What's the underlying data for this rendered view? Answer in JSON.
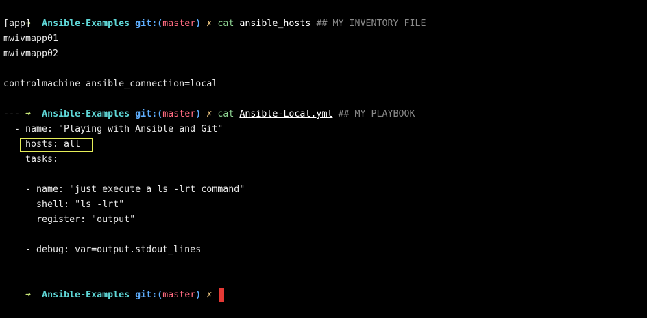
{
  "prompt": {
    "arrow": "➜",
    "directory": "Ansible-Examples",
    "git_label": "git:(",
    "branch": "master",
    "git_close": ")",
    "dirty_mark": "✗"
  },
  "commands": [
    {
      "cmd": "cat",
      "file": "ansible_hosts",
      "comment": "## MY INVENTORY FILE"
    },
    {
      "cmd": "cat",
      "file": "Ansible-Local.yml",
      "comment": "## MY PLAYBOOK"
    }
  ],
  "inventory_output": [
    "[app]",
    "mwivmapp01",
    "mwivmapp02",
    "",
    "controlmachine ansible_connection=local"
  ],
  "playbook_output": [
    "---",
    "  - name: \"Playing with Ansible and Git\"",
    "    hosts: all",
    "    tasks:",
    "",
    "    - name: \"just execute a ls -lrt command\"",
    "      shell: \"ls -lrt\"",
    "      register: \"output\"",
    "",
    "    - debug: var=output.stdout_lines"
  ],
  "colors": {
    "background": "#000000",
    "arrow": "#c5e478",
    "directory": "#5fd7d7",
    "branch": "#ff6b81",
    "highlight": "#e6ee59",
    "cursor": "#e53935"
  }
}
